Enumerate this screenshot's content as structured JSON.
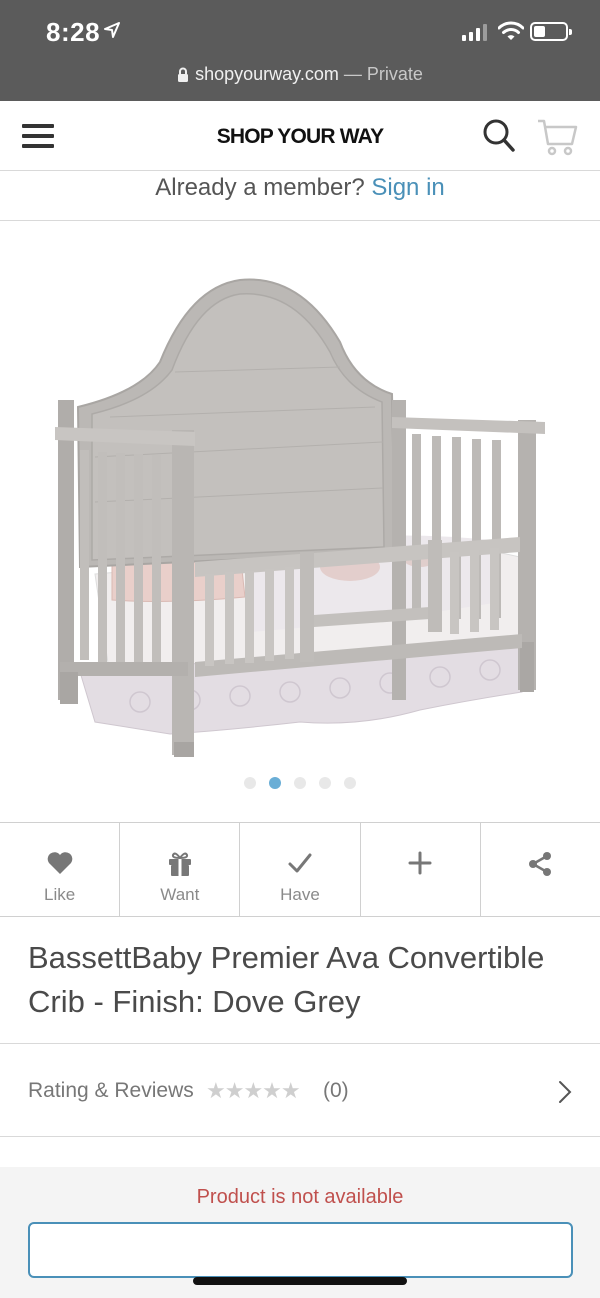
{
  "status_bar": {
    "time": "8:28"
  },
  "browser": {
    "url": "shopyourway.com",
    "separator": " — ",
    "mode": "Private"
  },
  "header": {
    "brand": "SHOP YOUR WAY",
    "icons": [
      "menu-icon",
      "search-icon",
      "cart-icon"
    ]
  },
  "member": {
    "prompt": "Already a member?",
    "link": "Sign in"
  },
  "carousel": {
    "slide_count": 5,
    "active_index": 1
  },
  "actions": [
    {
      "label": "Like",
      "icon": "heart-icon"
    },
    {
      "label": "Want",
      "icon": "gift-icon"
    },
    {
      "label": "Have",
      "icon": "check-icon"
    },
    {
      "label": "",
      "icon": "plus-icon"
    },
    {
      "label": "",
      "icon": "share-icon"
    }
  ],
  "product": {
    "title": "BassettBaby Premier Ava Convertible Crib - Finish: Dove Grey",
    "rating_label": "Rating & Reviews",
    "rating_stars": 0,
    "review_count": "(0)"
  },
  "availability": {
    "message": "Product is not available"
  },
  "colors": {
    "accent": "#4a90b8",
    "error": "#c0504d",
    "status_bar": "#5b5b5b"
  }
}
